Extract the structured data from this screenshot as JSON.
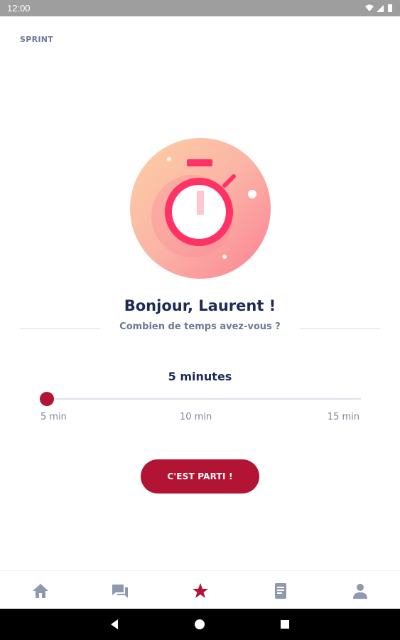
{
  "status_bar": {
    "time": "12:00"
  },
  "header": {
    "title": "SPRINT"
  },
  "main": {
    "greeting": "Bonjour, Laurent !",
    "prompt": "Combien de temps avez-vous ?",
    "duration_label": "5 minutes",
    "slider": {
      "min_label": "5 min",
      "mid_label": "10 min",
      "max_label": "15 min",
      "value": 5,
      "min": 5,
      "max": 15
    },
    "cta_label": "C'EST PARTI !"
  },
  "bottom_nav": {
    "items": [
      {
        "icon": "home-icon",
        "active": false
      },
      {
        "icon": "chat-icon",
        "active": false
      },
      {
        "icon": "star-icon",
        "active": true
      },
      {
        "icon": "book-icon",
        "active": false
      },
      {
        "icon": "profile-icon",
        "active": false
      }
    ]
  },
  "colors": {
    "accent": "#b41434",
    "heading": "#1c2a55",
    "muted": "#6b7a94",
    "nav_inactive": "#8e99ad"
  }
}
